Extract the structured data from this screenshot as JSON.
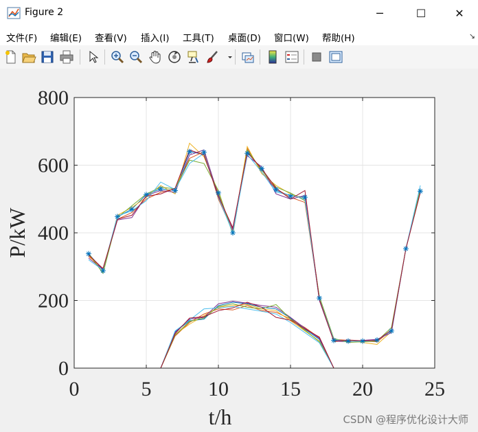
{
  "window": {
    "title": "Figure 2",
    "minimize_glyph": "─",
    "maximize_glyph": "☐",
    "close_glyph": "✕"
  },
  "menu": {
    "items": [
      "文件(F)",
      "编辑(E)",
      "查看(V)",
      "插入(I)",
      "工具(T)",
      "桌面(D)",
      "窗口(W)",
      "帮助(H)"
    ],
    "overflow_glyph": "↘"
  },
  "toolbar": {
    "icons": [
      "new-figure-icon",
      "open-file-icon",
      "save-icon",
      "print-icon",
      "pointer-icon",
      "zoom-in-icon",
      "zoom-out-icon",
      "pan-hand-icon",
      "rotate-3d-icon",
      "data-cursor-icon",
      "brush-icon",
      "link-plot-icon",
      "colorbar-icon",
      "legend-icon",
      "hide-plot-tools-icon",
      "show-plot-tools-icon"
    ]
  },
  "colors": {
    "axes_bg": "#ffffff",
    "figure_bg": "#f0f0f0",
    "grid": "#e4e4e4",
    "series": [
      "#0072BD",
      "#D95319",
      "#EDB120",
      "#7E2F8E",
      "#77AC30",
      "#4DBEEE",
      "#A2142F"
    ],
    "marker": "#0072BD"
  },
  "watermark": "CSDN @程序优化设计大师",
  "chart_data": {
    "type": "line",
    "title": "",
    "xlabel": "t/h",
    "ylabel": "P/kW",
    "xlim": [
      0,
      25
    ],
    "ylim": [
      0,
      800
    ],
    "xticks": [
      0,
      5,
      10,
      15,
      20,
      25
    ],
    "yticks": [
      0,
      200,
      400,
      600,
      800
    ],
    "grid": true,
    "legend": "none",
    "x": [
      1,
      2,
      3,
      4,
      5,
      6,
      7,
      8,
      9,
      10,
      11,
      12,
      13,
      14,
      15,
      16,
      17,
      18,
      19,
      20,
      21,
      22,
      23,
      24
    ],
    "marker_series": [
      {
        "marker": "*",
        "values": [
          338,
          288,
          448,
          470,
          513,
          530,
          525,
          640,
          638,
          518,
          400,
          635,
          590,
          528,
          508,
          505,
          207,
          82,
          80,
          80,
          83,
          110,
          353,
          523
        ]
      }
    ],
    "upper_group": [
      {
        "values": [
          338,
          290,
          447,
          470,
          513,
          530,
          525,
          640,
          632,
          515,
          400,
          640,
          588,
          525,
          510,
          505,
          208,
          82,
          80,
          80,
          82,
          110,
          353,
          522
        ]
      },
      {
        "values": [
          330,
          295,
          440,
          460,
          500,
          520,
          530,
          620,
          640,
          500,
          405,
          650,
          580,
          530,
          505,
          490,
          205,
          85,
          82,
          80,
          78,
          112,
          353,
          528
        ]
      },
      {
        "values": [
          335,
          282,
          452,
          475,
          505,
          540,
          515,
          665,
          625,
          520,
          398,
          655,
          575,
          540,
          515,
          500,
          210,
          78,
          82,
          76,
          70,
          108,
          353,
          520
        ]
      },
      {
        "values": [
          325,
          292,
          438,
          445,
          510,
          525,
          520,
          630,
          645,
          510,
          410,
          628,
          595,
          515,
          500,
          510,
          200,
          80,
          78,
          82,
          85,
          105,
          353,
          525
        ]
      },
      {
        "values": [
          340,
          280,
          445,
          480,
          515,
          535,
          530,
          615,
          605,
          525,
          395,
          645,
          585,
          535,
          518,
          495,
          212,
          88,
          76,
          78,
          80,
          120,
          353,
          530
        ]
      },
      {
        "values": [
          320,
          290,
          450,
          465,
          495,
          550,
          528,
          605,
          635,
          505,
          400,
          632,
          580,
          520,
          512,
          500,
          205,
          84,
          80,
          79,
          83,
          110,
          353,
          540
        ]
      },
      {
        "values": [
          335,
          294,
          440,
          452,
          508,
          515,
          532,
          645,
          630,
          508,
          415,
          638,
          590,
          532,
          500,
          525,
          203,
          80,
          83,
          81,
          82,
          113,
          353,
          519
        ]
      }
    ],
    "lower_group": [
      {
        "values": [
          0,
          0,
          0,
          0,
          0,
          0,
          108,
          140,
          145,
          185,
          195,
          190,
          180,
          175,
          148,
          115,
          85,
          0,
          0,
          0,
          0,
          0,
          0,
          0
        ]
      },
      {
        "values": [
          0,
          0,
          0,
          0,
          0,
          0,
          95,
          135,
          160,
          175,
          172,
          185,
          170,
          165,
          145,
          120,
          90,
          0,
          0,
          0,
          0,
          0,
          0,
          0
        ]
      },
      {
        "values": [
          0,
          0,
          0,
          0,
          0,
          0,
          100,
          130,
          155,
          180,
          185,
          188,
          175,
          170,
          140,
          110,
          80,
          0,
          0,
          0,
          0,
          0,
          0,
          0
        ]
      },
      {
        "values": [
          0,
          0,
          0,
          0,
          0,
          0,
          105,
          145,
          150,
          190,
          198,
          192,
          185,
          180,
          150,
          118,
          88,
          0,
          0,
          0,
          0,
          0,
          0,
          0
        ]
      },
      {
        "values": [
          0,
          0,
          0,
          0,
          0,
          0,
          98,
          138,
          148,
          182,
          190,
          180,
          175,
          188,
          145,
          112,
          78,
          0,
          0,
          0,
          0,
          0,
          0,
          0
        ]
      },
      {
        "values": [
          0,
          0,
          0,
          0,
          0,
          0,
          110,
          142,
          175,
          178,
          182,
          175,
          168,
          160,
          135,
          105,
          75,
          0,
          0,
          0,
          0,
          0,
          0,
          0
        ]
      },
      {
        "values": [
          0,
          0,
          0,
          0,
          0,
          0,
          102,
          148,
          152,
          170,
          178,
          195,
          180,
          150,
          142,
          116,
          92,
          0,
          0,
          0,
          0,
          0,
          0,
          0
        ]
      }
    ]
  }
}
